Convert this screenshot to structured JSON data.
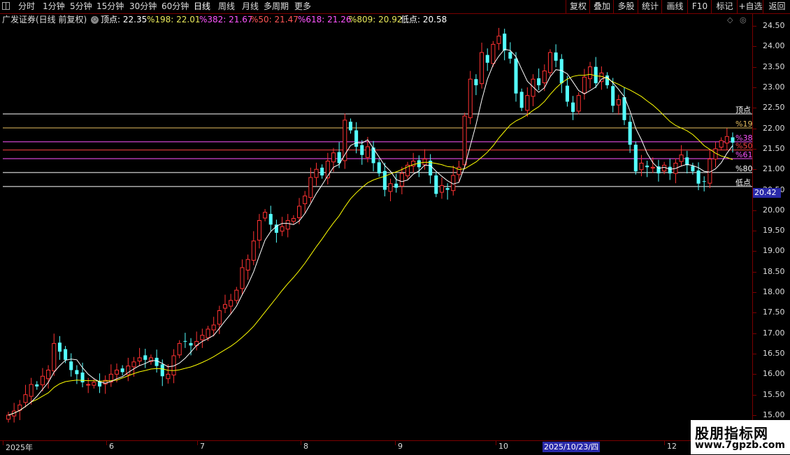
{
  "toolbar": {
    "tabs": [
      {
        "label": "分时"
      },
      {
        "label": "1分钟"
      },
      {
        "label": "5分钟"
      },
      {
        "label": "15分钟"
      },
      {
        "label": "30分钟"
      },
      {
        "label": "60分钟"
      },
      {
        "label": "日线"
      },
      {
        "label": "周线"
      },
      {
        "label": "月线"
      },
      {
        "label": "多周期"
      },
      {
        "label": "更多"
      }
    ],
    "right_buttons": [
      {
        "label": "复权"
      },
      {
        "label": "叠加"
      },
      {
        "label": "多股"
      },
      {
        "label": "统计"
      },
      {
        "label": "画线"
      },
      {
        "label": "F10"
      },
      {
        "label": "标记"
      },
      {
        "label": "+自选"
      },
      {
        "label": "返回"
      }
    ]
  },
  "info": {
    "stock": "广发证券(日线 前复权)",
    "items": [
      {
        "label": "顶点: 22.35",
        "color": "#ffffff"
      },
      {
        "label": "%198: 22.01",
        "color": "#e8e85a"
      },
      {
        "label": "%382: 21.67",
        "color": "#ff55ff"
      },
      {
        "label": "%50: 21.47",
        "color": "#ff5555"
      },
      {
        "label": "%618: 21.26",
        "color": "#ff55ff"
      },
      {
        "label": "%809: 20.92",
        "color": "#e8e85a"
      },
      {
        "label": "低点: 20.58",
        "color": "#ffffff"
      }
    ]
  },
  "levels": [
    {
      "label": "顶点",
      "value": 22.35,
      "color": "#ffffff"
    },
    {
      "label": "%19",
      "value": 22.01,
      "color": "#e8c060"
    },
    {
      "label": "%38",
      "value": 21.67,
      "color": "#ff55ff"
    },
    {
      "label": "%50",
      "value": 21.47,
      "color": "#ff4444"
    },
    {
      "label": "%61",
      "value": 21.26,
      "color": "#ff55ff"
    },
    {
      "label": "%80",
      "value": 20.92,
      "color": "#ffffff"
    },
    {
      "label": "低点",
      "value": 20.58,
      "color": "#ffffff"
    }
  ],
  "yaxis": {
    "ticks": [
      "24.50",
      "24.00",
      "23.50",
      "23.00",
      "22.50",
      "22.00",
      "21.50",
      "21.00",
      "20.50",
      "20.00",
      "19.50",
      "19.00",
      "18.50",
      "18.00",
      "17.50",
      "17.00",
      "16.50",
      "16.00",
      "15.50",
      "15.00"
    ],
    "current_price": "20.42"
  },
  "xaxis": {
    "ticks": [
      "2025年",
      "6",
      "7",
      "8",
      "9",
      "10",
      "12"
    ],
    "cursor_date": "2025/10/23/四"
  },
  "watermark": {
    "line1": "股朋指标网",
    "line2": "www.7gpzb.com"
  },
  "colors": {
    "up": "#ff3232",
    "down": "#54ffff",
    "ma_fast": "#ffffff",
    "ma_slow": "#ffff00",
    "border": "#7a0000"
  },
  "chart_data": {
    "type": "candlestick",
    "ylim": [
      15.0,
      24.5
    ],
    "ma_fast_period": "MA5",
    "ma_slow_period": "MA20",
    "closes": [
      15.0,
      15.1,
      15.25,
      15.5,
      15.75,
      15.7,
      15.95,
      16.1,
      16.75,
      16.55,
      16.35,
      16.1,
      16.0,
      15.8,
      15.75,
      15.8,
      15.7,
      15.85,
      16.0,
      16.1,
      16.05,
      16.2,
      16.3,
      16.4,
      16.35,
      16.4,
      16.2,
      15.95,
      16.0,
      16.45,
      16.75,
      16.8,
      16.7,
      16.8,
      16.95,
      17.1,
      17.2,
      17.55,
      17.7,
      17.8,
      18.05,
      18.6,
      18.8,
      19.25,
      19.75,
      19.95,
      19.65,
      19.45,
      19.6,
      19.75,
      19.8,
      20.1,
      20.35,
      20.8,
      21.0,
      20.85,
      21.2,
      21.4,
      21.15,
      22.2,
      21.95,
      21.55,
      21.35,
      21.55,
      21.15,
      20.9,
      20.5,
      20.65,
      20.55,
      20.9,
      21.1,
      21.2,
      21.05,
      21.25,
      20.85,
      20.4,
      20.6,
      20.5,
      20.85,
      21.05,
      22.3,
      23.2,
      23.05,
      23.85,
      23.6,
      24.05,
      24.25,
      23.9,
      23.7,
      22.85,
      22.5,
      22.8,
      23.2,
      23.05,
      23.4,
      23.85,
      23.65,
      23.1,
      22.65,
      22.4,
      22.8,
      23.25,
      23.5,
      23.1,
      23.35,
      23.05,
      22.55,
      22.7,
      22.2,
      21.6,
      20.95,
      21.15,
      21.05,
      21.05,
      20.9,
      21.1,
      20.9,
      21.15,
      21.35,
      21.1,
      20.95,
      20.65,
      20.7,
      21.25,
      21.5,
      21.7,
      21.8,
      21.65
    ],
    "levels": [
      22.35,
      22.01,
      21.67,
      21.47,
      21.26,
      20.92,
      20.58
    ]
  }
}
